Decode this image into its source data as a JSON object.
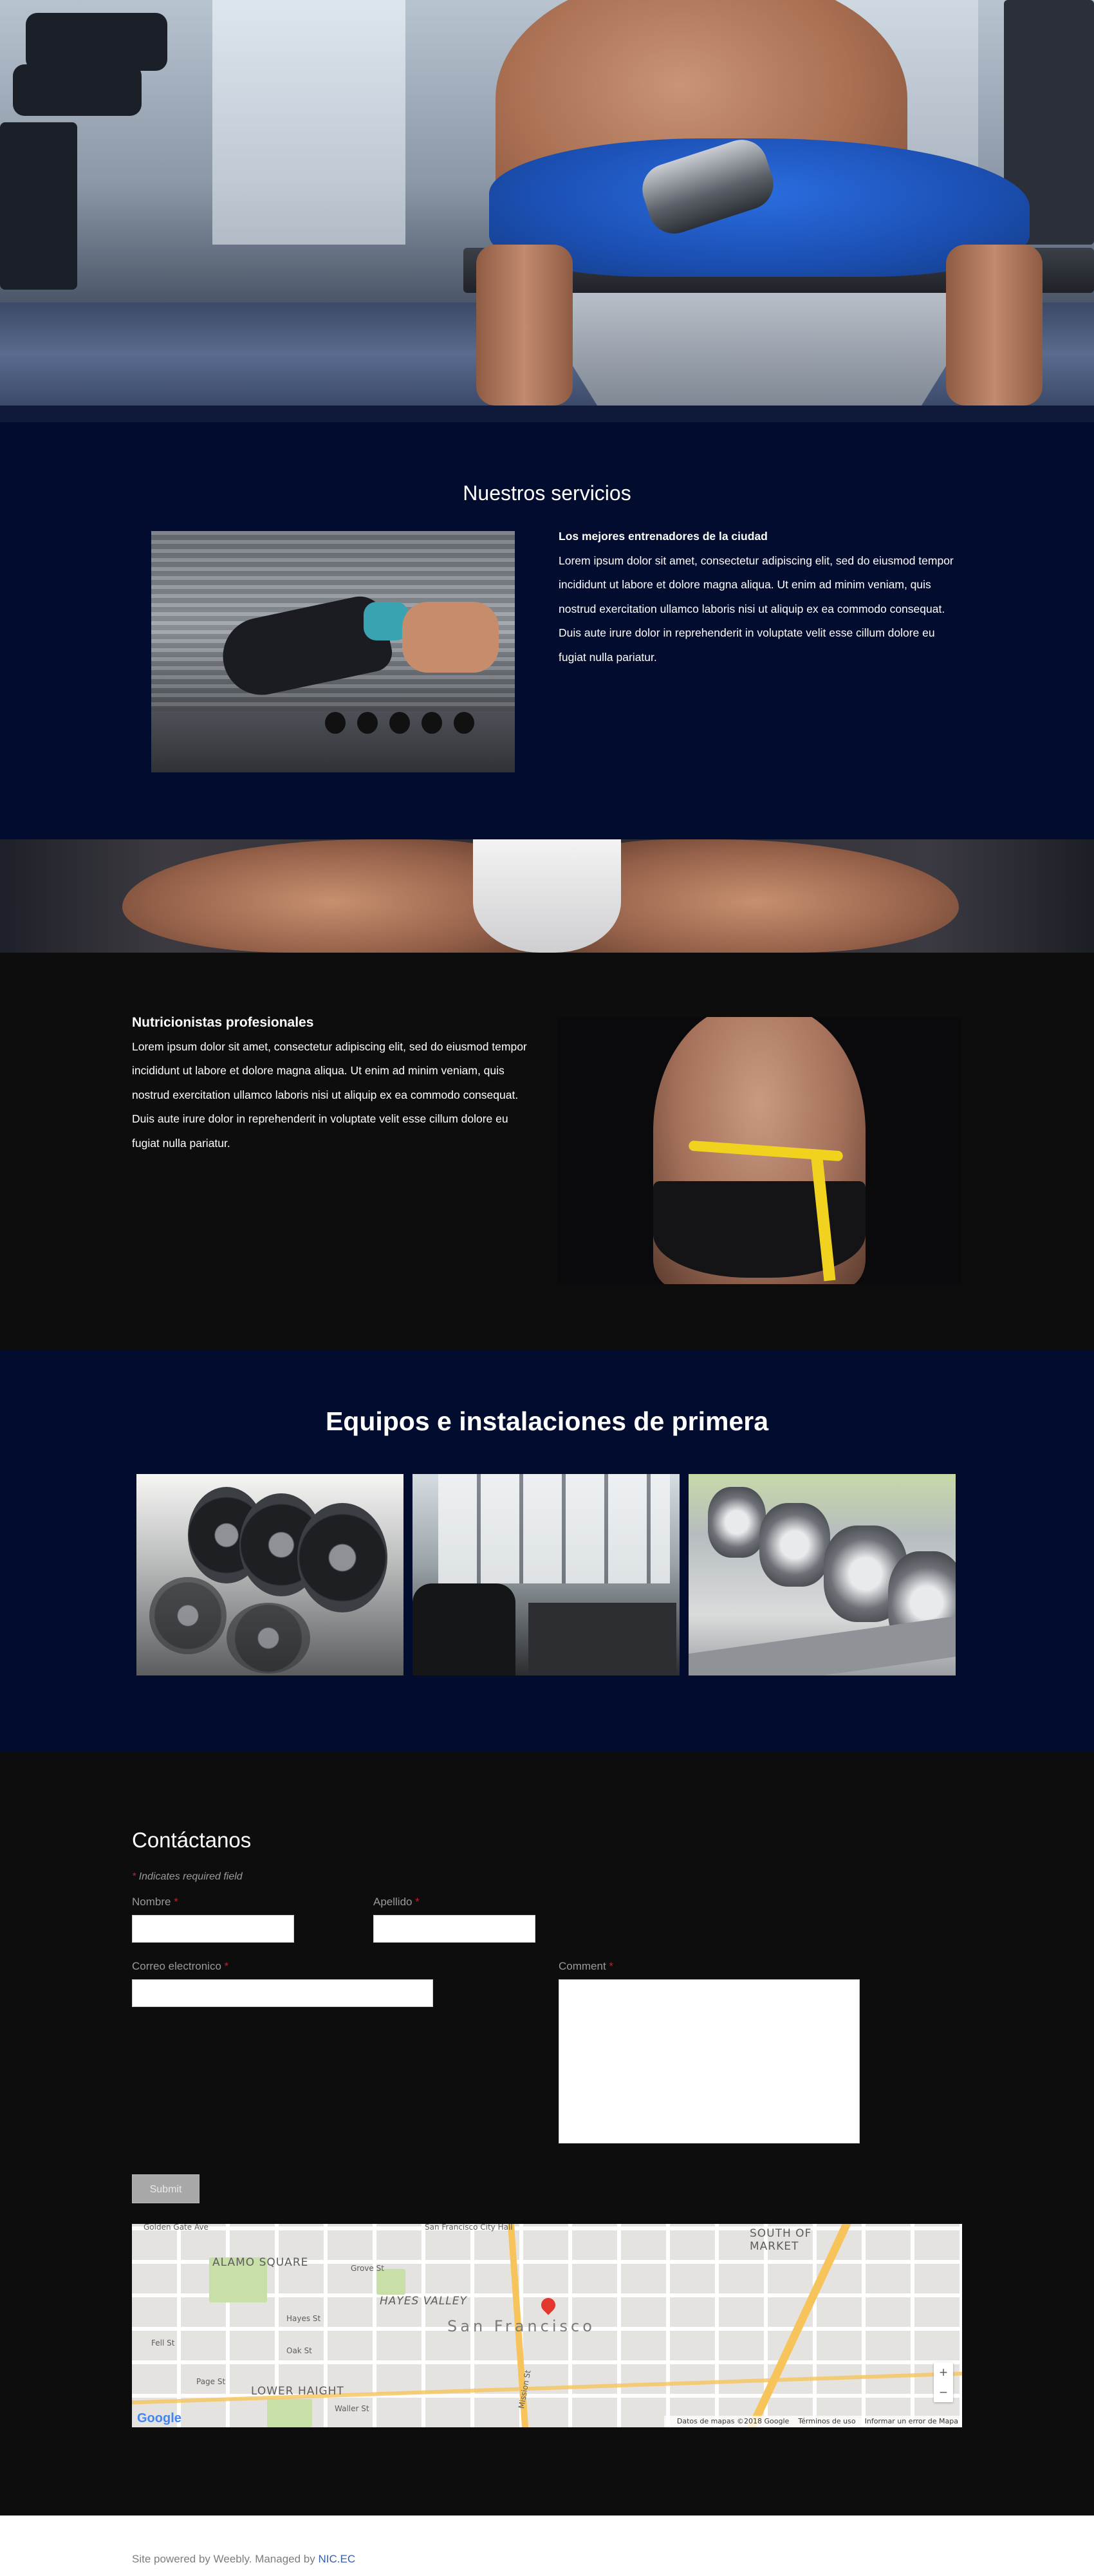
{
  "services": {
    "title": "Nuestros servicios",
    "heading": "Los mejores entrenadores de la ciudad",
    "body": "Lorem ipsum dolor sit amet, consectetur adipiscing elit, sed do eiusmod tempor incididunt ut labore et dolore magna aliqua. Ut enim ad minim veniam, quis nostrud exercitation ullamco laboris nisi ut aliquip ex ea commodo consequat. Duis aute irure dolor in reprehenderit in voluptate velit esse cillum dolore eu fugiat nulla pariatur."
  },
  "nutrition": {
    "heading": "Nutricionistas profesionales",
    "body": "Lorem ipsum dolor sit amet, consectetur adipiscing elit, sed do eiusmod tempor incididunt ut labore et dolore magna aliqua. Ut enim ad minim veniam, quis nostrud exercitation ullamco laboris nisi ut aliquip ex ea commodo consequat. Duis aute irure dolor in reprehenderit in voluptate velit esse cillum dolore eu fugiat nulla pariatur."
  },
  "equipment": {
    "title": "Equipos e instalaciones de primera"
  },
  "contact": {
    "title": "Contáctanos",
    "required_note": "Indicates required field",
    "required_marker": "*",
    "first_name_label": "Nombre",
    "last_name_label": "Apellido",
    "email_label": "Correo electronico",
    "comment_label": "Comment",
    "first_name_value": "",
    "last_name_value": "",
    "email_value": "",
    "comment_value": "",
    "submit_label": "Submit"
  },
  "map": {
    "labels": {
      "alamo_square": "ALAMO SQUARE",
      "hayes_valley": "HAYES VALLEY",
      "south_of_market": "SOUTH OF MARKET",
      "lower_haight": "LOWER HAIGHT",
      "city": "San Francisco",
      "city_hall": "San Francisco City Hall",
      "mission_st": "Mission St",
      "golden_gate_ave": "Golden Gate Ave",
      "fell_st": "Fell St",
      "oak_st": "Oak St",
      "hayes_st": "Hayes St",
      "page_st": "Page St",
      "grove_st": "Grove St",
      "waller_st": "Waller St"
    },
    "zoom_in": "+",
    "zoom_out": "−",
    "attribution_data": "Datos de mapas ©2018 Google",
    "attribution_terms": "Términos de uso",
    "attribution_report": "Informar un error de Mapa",
    "google_logo": "Google"
  },
  "footer": {
    "text": "Site powered by Weebly. Managed by ",
    "link": "NIC.EC"
  },
  "colors": {
    "navy": "#020c2e",
    "black": "#0d0d0d",
    "required": "#d0192c",
    "link": "#3a5fa6"
  }
}
